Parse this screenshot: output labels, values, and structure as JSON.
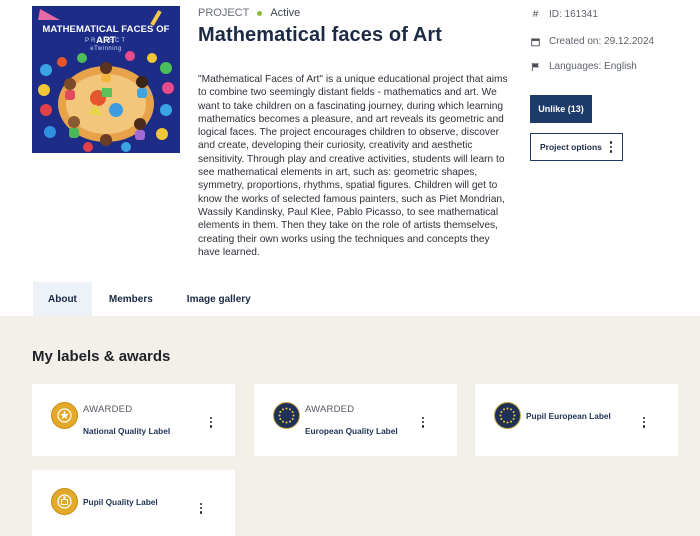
{
  "project": {
    "kicker": "PROJECT",
    "status": "Active",
    "status_color": "#8bbd3a",
    "title": "Mathematical faces of Art",
    "cover": {
      "title": "MATHEMATICAL FACES OF ART",
      "sub": "PROJECT",
      "sub2": "eTwinning"
    },
    "description": "\"Mathematical Faces of Art\" is a unique educational project that aims to combine two seemingly distant fields - mathematics and art. We want to take children on a fascinating journey, during which learning mathematics becomes a pleasure, and art reveals its geometric and logical faces. The project encourages children to observe, discover and create, developing their curiosity, creativity and aesthetic sensitivity. Through play and creative activities, students will learn to see mathematical elements in art, such as: geometric shapes, symmetry, proportions, rhythms, spatial figures. Children will get to know the works of selected famous painters, such as Piet Mondrian, Wassily Kandinsky, Paul Klee, Pablo Picasso, to see mathematical elements in them. Then they take on the role of artists themselves, creating their own works using the techniques and concepts they have learned."
  },
  "meta": {
    "id": "ID: 161341",
    "created": "Created on: 29.12.2024",
    "languages": "Languages: English",
    "icons": [
      "hash-icon",
      "calendar-icon",
      "flag-icon"
    ]
  },
  "actions": {
    "unlike": "Unlike (13)",
    "options": "Project options",
    "primary_color": "#1c3b6b"
  },
  "tabs": [
    {
      "label": "About",
      "active": true
    },
    {
      "label": "Members",
      "active": false
    },
    {
      "label": "Image gallery",
      "active": false
    }
  ],
  "labels_section": {
    "heading": "My labels & awards",
    "cards": [
      {
        "overline": "AWARDED",
        "name": "National Quality Label",
        "badge": "gold-star-badge-icon"
      },
      {
        "overline": "AWARDED",
        "name": "European Quality Label",
        "badge": "eu-stars-badge-icon"
      },
      {
        "overline": "",
        "name": "Pupil European Label",
        "badge": "eu-stars-badge-icon"
      },
      {
        "overline": "",
        "name": "Pupil Quality Label",
        "badge": "gold-pupil-badge-icon"
      }
    ]
  }
}
